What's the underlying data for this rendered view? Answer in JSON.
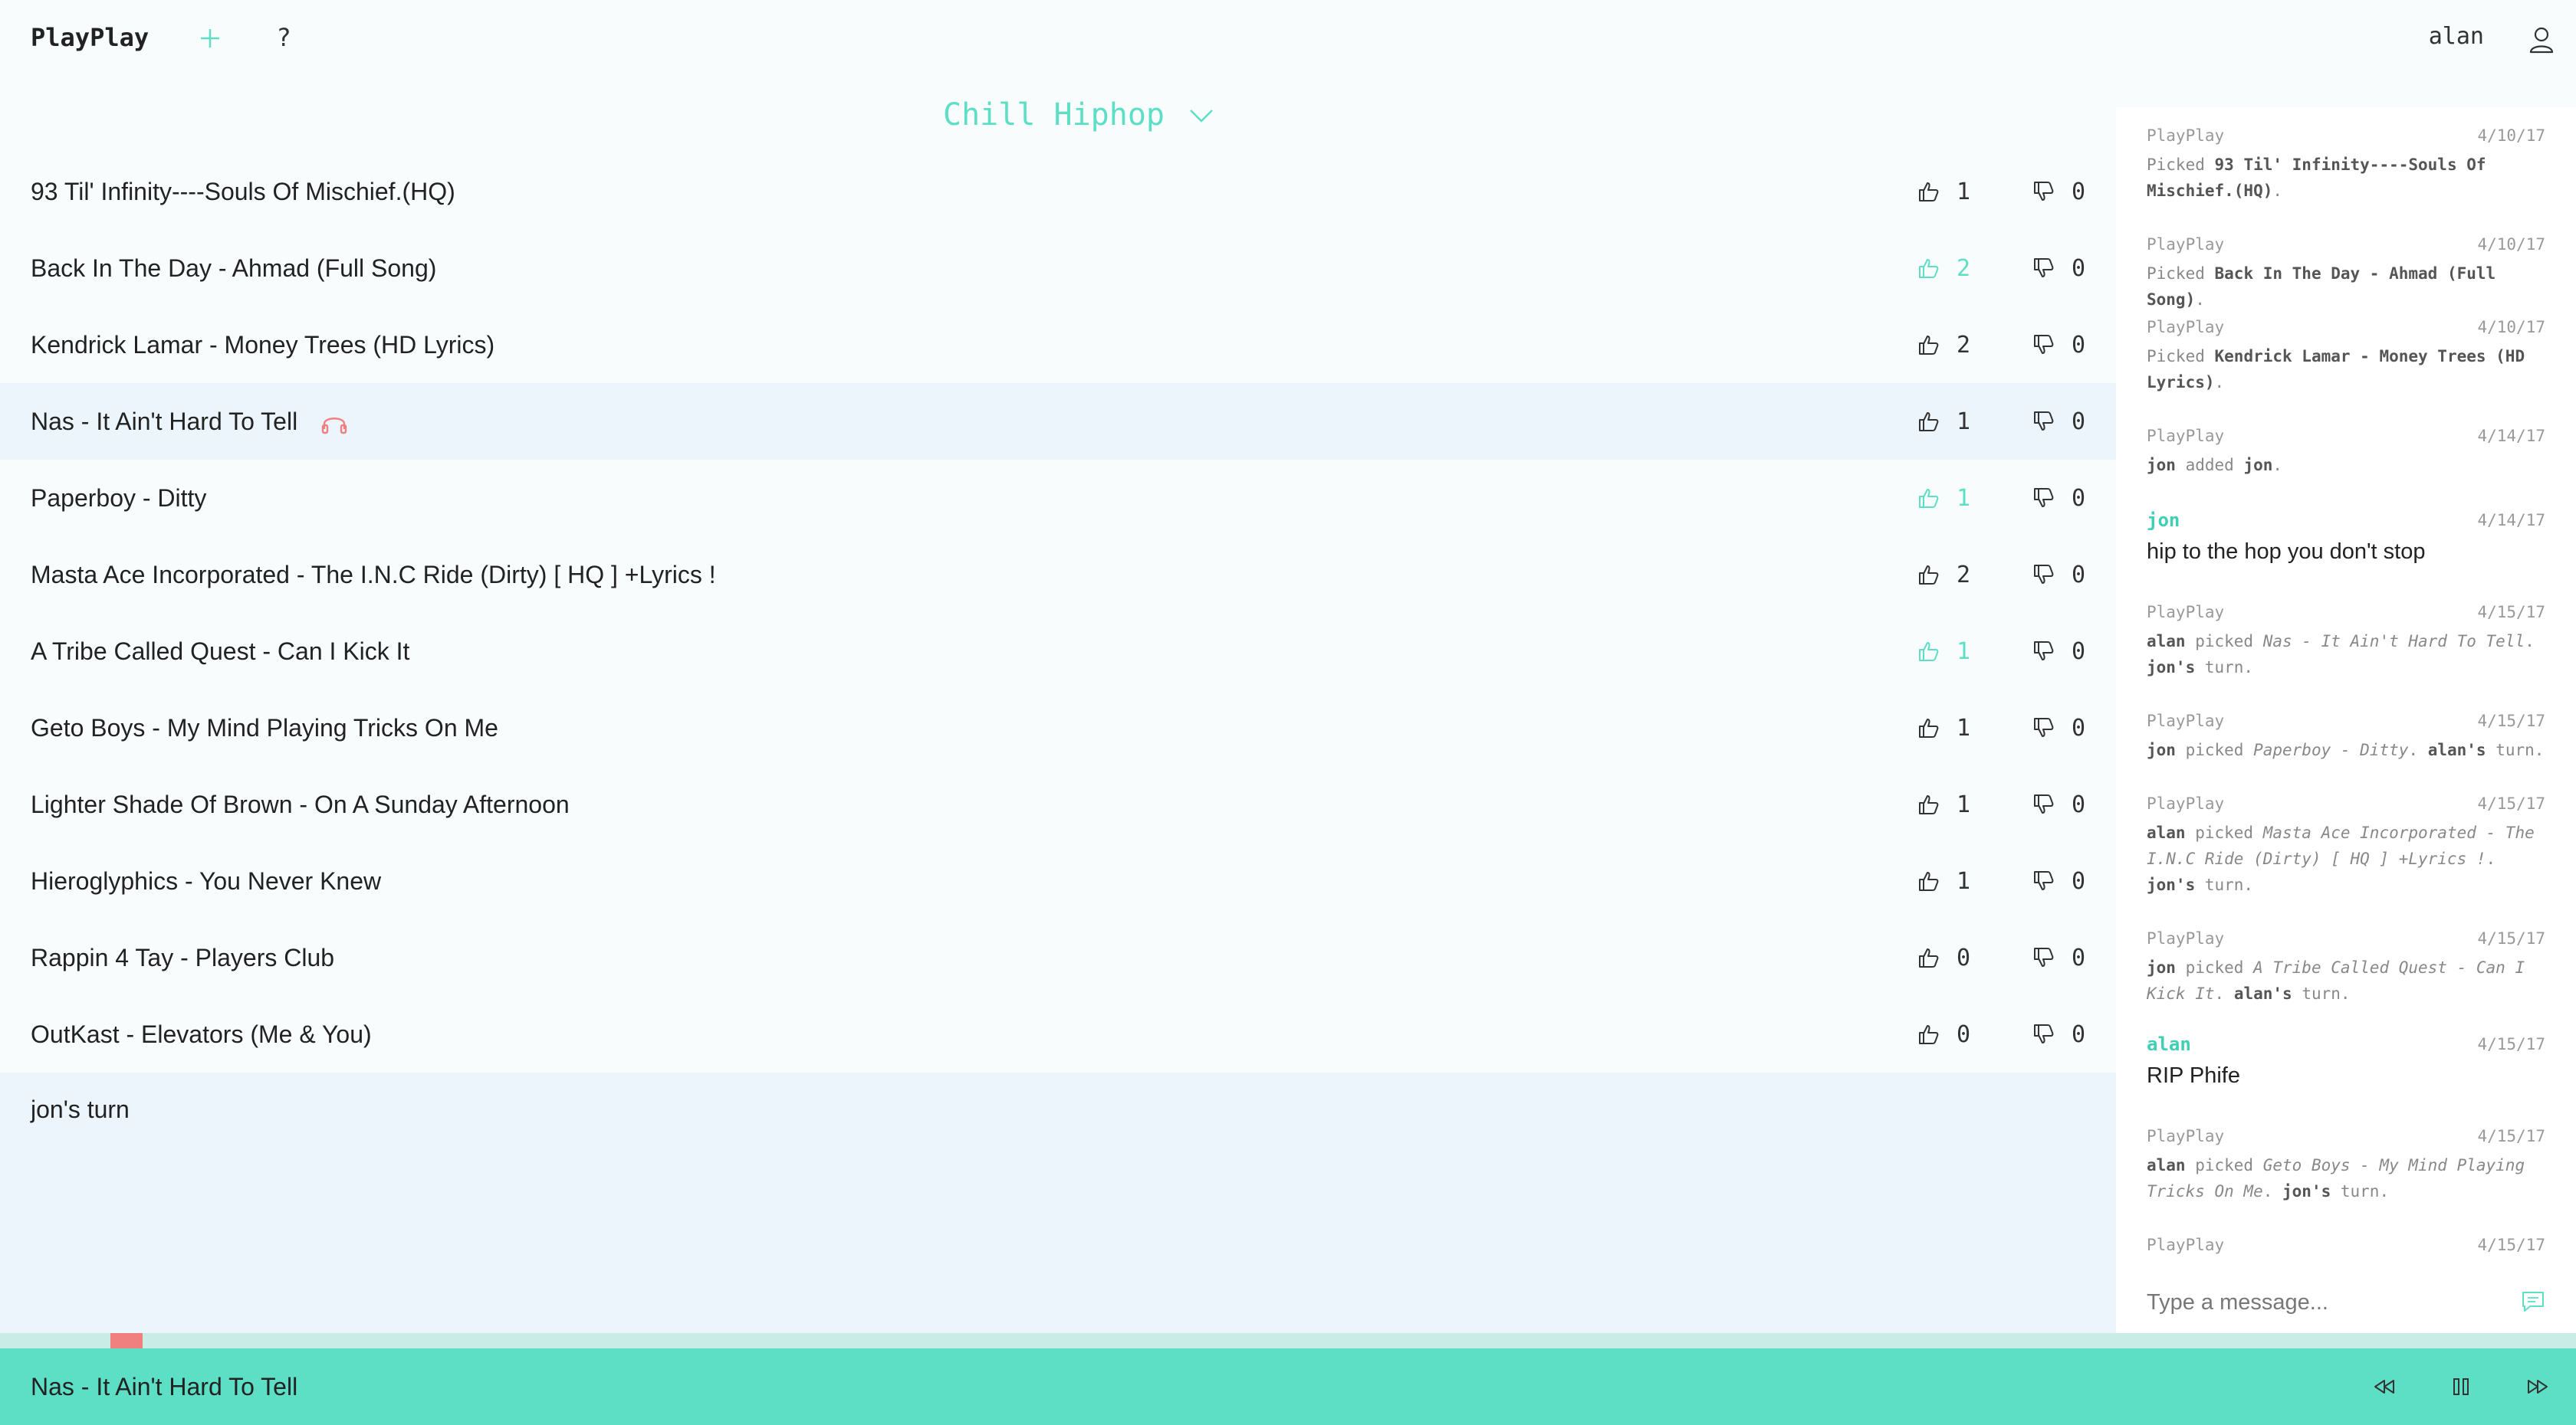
{
  "header": {
    "brand": "PlayPlay",
    "help": "?",
    "username": "alan"
  },
  "playlist": {
    "title": "Chill Hiphop"
  },
  "tracks": [
    {
      "title": "93 Til' Infinity----Souls Of Mischief.(HQ)",
      "up": "1",
      "down": "0",
      "up_active": false,
      "playing": false
    },
    {
      "title": "Back In The Day - Ahmad (Full Song)",
      "up": "2",
      "down": "0",
      "up_active": true,
      "playing": false
    },
    {
      "title": "Kendrick Lamar - Money Trees (HD Lyrics)",
      "up": "2",
      "down": "0",
      "up_active": false,
      "playing": false
    },
    {
      "title": "Nas - It Ain't Hard To Tell",
      "up": "1",
      "down": "0",
      "up_active": false,
      "playing": true
    },
    {
      "title": "Paperboy - Ditty",
      "up": "1",
      "down": "0",
      "up_active": true,
      "playing": false
    },
    {
      "title": "Masta Ace Incorporated - The I.N.C Ride (Dirty) [ HQ ] +Lyrics !",
      "up": "2",
      "down": "0",
      "up_active": false,
      "playing": false
    },
    {
      "title": "A Tribe Called Quest - Can I Kick It",
      "up": "1",
      "down": "0",
      "up_active": true,
      "playing": false
    },
    {
      "title": "Geto Boys - My Mind Playing Tricks On Me",
      "up": "1",
      "down": "0",
      "up_active": false,
      "playing": false
    },
    {
      "title": "Lighter Shade Of Brown - On A Sunday Afternoon",
      "up": "1",
      "down": "0",
      "up_active": false,
      "playing": false
    },
    {
      "title": "Hieroglyphics - You Never Knew",
      "up": "1",
      "down": "0",
      "up_active": false,
      "playing": false
    },
    {
      "title": "Rappin 4 Tay - Players Club",
      "up": "0",
      "down": "0",
      "up_active": false,
      "playing": false
    },
    {
      "title": "OutKast - Elevators (Me & You)",
      "up": "0",
      "down": "0",
      "up_active": false,
      "playing": false
    }
  ],
  "turn": "jon's turn",
  "chat": {
    "messages": [
      {
        "sender": "PlayPlay",
        "date": "4/10/17",
        "type": "system",
        "parts": [
          [
            "t",
            "Picked "
          ],
          [
            "b",
            "93 Til' Infinity----Souls Of Mischief.(HQ)"
          ],
          [
            "t",
            "."
          ]
        ]
      },
      {
        "sender": "PlayPlay",
        "date": "4/10/17",
        "type": "system",
        "parts": [
          [
            "t",
            "Picked "
          ],
          [
            "b",
            "Back In The Day - Ahmad (Full Song)"
          ],
          [
            "t",
            "."
          ]
        ]
      },
      {
        "sender": "PlayPlay",
        "date": "4/10/17",
        "type": "system",
        "parts": [
          [
            "t",
            "Picked "
          ],
          [
            "b",
            "Kendrick Lamar - Money Trees (HD Lyrics)"
          ],
          [
            "t",
            "."
          ]
        ]
      },
      {
        "sender": "PlayPlay",
        "date": "4/14/17",
        "type": "system",
        "parts": [
          [
            "b",
            "jon"
          ],
          [
            "t",
            " added "
          ],
          [
            "b",
            "jon"
          ],
          [
            "t",
            "."
          ]
        ]
      },
      {
        "sender": "jon",
        "date": "4/14/17",
        "type": "user",
        "text": "hip to the hop you don't stop"
      },
      {
        "sender": "PlayPlay",
        "date": "4/15/17",
        "type": "system",
        "parts": [
          [
            "b",
            "alan"
          ],
          [
            "t",
            " picked "
          ],
          [
            "i",
            "Nas - It Ain't Hard To Tell"
          ],
          [
            "t",
            ". "
          ],
          [
            "b",
            "jon's"
          ],
          [
            "t",
            " turn."
          ]
        ]
      },
      {
        "sender": "PlayPlay",
        "date": "4/15/17",
        "type": "system",
        "parts": [
          [
            "b",
            "jon"
          ],
          [
            "t",
            " picked "
          ],
          [
            "i",
            "Paperboy - Ditty"
          ],
          [
            "t",
            ". "
          ],
          [
            "b",
            "alan's"
          ],
          [
            "t",
            " turn."
          ]
        ]
      },
      {
        "sender": "PlayPlay",
        "date": "4/15/17",
        "type": "system",
        "parts": [
          [
            "b",
            "alan"
          ],
          [
            "t",
            " picked "
          ],
          [
            "i",
            "Masta Ace Incorporated - The I.N.C Ride (Dirty) [ HQ ] +Lyrics !"
          ],
          [
            "t",
            ". "
          ],
          [
            "b",
            "jon's"
          ],
          [
            "t",
            " turn."
          ]
        ]
      },
      {
        "sender": "PlayPlay",
        "date": "4/15/17",
        "type": "system",
        "parts": [
          [
            "b",
            "jon"
          ],
          [
            "t",
            " picked "
          ],
          [
            "i",
            "A Tribe Called Quest - Can I Kick It"
          ],
          [
            "t",
            ". "
          ],
          [
            "b",
            "alan's"
          ],
          [
            "t",
            " turn."
          ]
        ]
      },
      {
        "sender": "alan",
        "date": "4/15/17",
        "type": "user",
        "text": "RIP Phife"
      },
      {
        "sender": "PlayPlay",
        "date": "4/15/17",
        "type": "system",
        "parts": [
          [
            "b",
            "alan"
          ],
          [
            "t",
            " picked "
          ],
          [
            "i",
            "Geto Boys - My Mind Playing Tricks On Me"
          ],
          [
            "t",
            ". "
          ],
          [
            "b",
            "jon's"
          ],
          [
            "t",
            " turn."
          ]
        ]
      },
      {
        "sender": "PlayPlay",
        "date": "4/15/17",
        "type": "system",
        "parts": []
      }
    ],
    "input_placeholder": "Type a message..."
  },
  "player": {
    "now_playing": "Nas - It Ain't Hard To Tell",
    "progress": 0.05
  },
  "colors": {
    "accent": "#5ddfc5",
    "highlight_row": "#ebf5fb",
    "progress_knob": "#f08080",
    "headphones": "#f08080"
  }
}
